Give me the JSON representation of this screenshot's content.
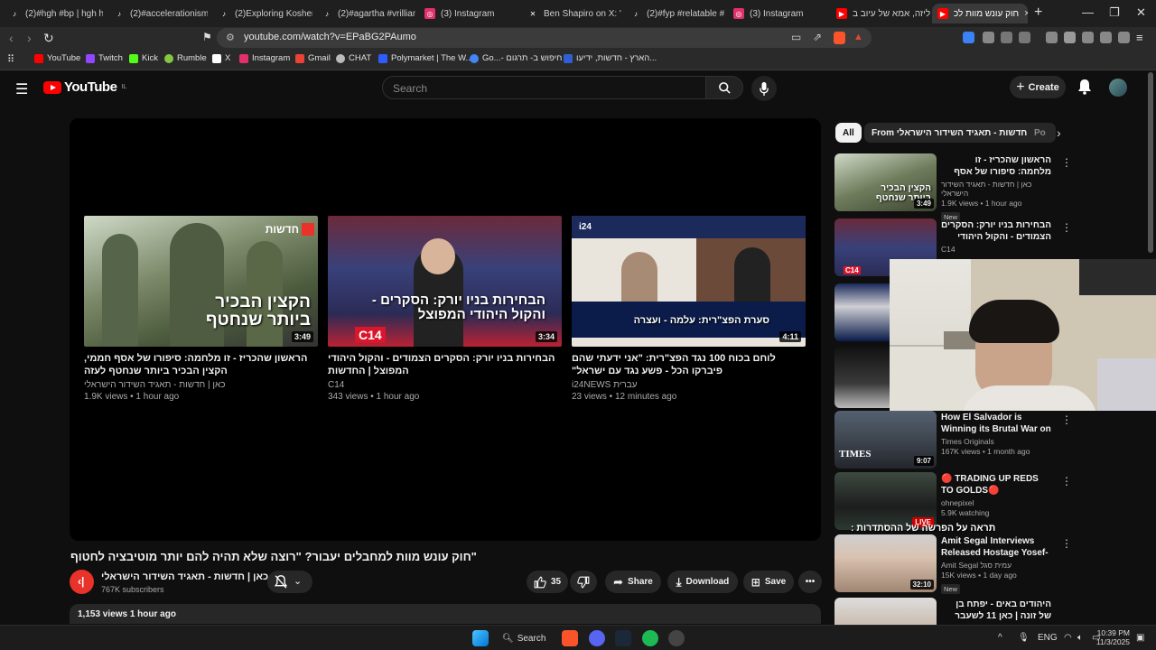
{
  "browser": {
    "tabs": [
      {
        "label": "(2)#hgh #bp | hgh hor",
        "icon": "tiktok-icon"
      },
      {
        "label": "(2)#accelerationism #",
        "icon": "tiktok-icon"
      },
      {
        "label": "(2)Exploring Kosher Cu",
        "icon": "tiktok-icon"
      },
      {
        "label": "(2)#agartha #vrilliant |",
        "icon": "tiktok-icon"
      },
      {
        "label": "(3) Instagram",
        "icon": "instagram-icon"
      },
      {
        "label": "Ben Shapiro on X: \"No",
        "icon": "x-icon"
      },
      {
        "label": "(2)#fyp #relatable #isr",
        "icon": "tiktok-icon"
      },
      {
        "label": "(3) Instagram",
        "icon": "instagram-icon"
      },
      {
        "label": "עליזה, אמא של עיוב ב",
        "icon": "youtube-icon"
      },
      {
        "label": "חוק עונש מוות לכ",
        "icon": "youtube-icon"
      }
    ],
    "new_tab": "+",
    "url": "youtube.com/watch?v=EPaBG2PAumo",
    "bookmarks": [
      {
        "label": "YouTube",
        "color": "#ff0000"
      },
      {
        "label": "Twitch",
        "color": "#9146ff"
      },
      {
        "label": "Kick",
        "color": "#53fc18"
      },
      {
        "label": "Rumble",
        "color": "#85c742"
      },
      {
        "label": "X",
        "color": "#ffffff"
      },
      {
        "label": "Instagram",
        "color": "#e1306c"
      },
      {
        "label": "Gmail",
        "color": "#ea4335"
      },
      {
        "label": "CHAT",
        "color": "#bbbbbb"
      },
      {
        "label": "Polymarket | The W...",
        "color": "#2e5cff"
      },
      {
        "label": "Go...- חיפוש ב- תרגום",
        "color": "#4285f4"
      },
      {
        "label": "הארץ - חדשות, ידיעו...",
        "color": "#2f5fd0"
      }
    ]
  },
  "youtube": {
    "logo": "YouTube",
    "region": "IL",
    "search_placeholder": "Search",
    "create_label": "Create",
    "endscreen": [
      {
        "title": "הראשון שהכריז - זו מלחמה: סיפורו של אסף חממי, הקצין הבכיר ביותר שנחטף לעזה",
        "channel": "כאן | חדשות - תאגיד השידור הישראלי",
        "meta": "1.9K views • 1 hour ago",
        "duration": "3:49",
        "overlay": "הקצין הבכיר ביותר שנחטף",
        "badge": "חדשות"
      },
      {
        "title": "הבחירות בניו יורק: הסקרים הצמודים - והקול היהודי המפוצל | החדשות",
        "channel": "C14",
        "meta": "343 views • 1 hour ago",
        "duration": "3:34",
        "overlay": "הבחירות בניו יורק: הסקרים - והקול היהודי המפוצל",
        "badge": "C14"
      },
      {
        "title": "לוחם בכוח 100 נגד הפצ\"רית: \"אני ידעתי שהם פיברקו הכל - פשע נגד עם ישראל\"",
        "channel": "i24NEWS עברית",
        "meta": "23 views • 12 minutes ago",
        "duration": "4:11",
        "overlay": "סערת הפצ\"רית: עלמה - ועצרה",
        "badge": "i24"
      }
    ],
    "video": {
      "title": "\"חוק עונש מוות למחבלים יעבור? \"רוצה שלא תהיה להם יותר מוטיבציה לחטוף",
      "channel": "כאן | חדשות - תאגיד השידור הישראלי",
      "subscribers": "767K subscribers",
      "likes": "35",
      "share": "Share",
      "download": "Download",
      "save": "Save",
      "views_time": "1,153 views  1 hour ago"
    },
    "chips": [
      "All",
      "From כאן | חדשות - תאגיד השידור הישראלי",
      "Po"
    ],
    "sidebar": [
      {
        "title": "הראשון שהכריז - זו מלחמה: סיפורו של אסף חממי, הקצין הבכיר ביותר",
        "channel": "כאן | חדשות - תאגיד השידור הישראלי",
        "meta": "1.9K views • 1 hour ago",
        "badge": "New",
        "duration": "3:49"
      },
      {
        "title": "הבחירות בניו יורק: הסקרים הצמודים - והקול היהודי המפוצל | החדשות",
        "channel": "C14",
        "meta": "",
        "badge": "",
        "duration": ""
      },
      {
        "title": "How El Salvador is Winning its Brutal War on Gangs",
        "channel": "Times Originals",
        "meta": "167K views • 1 month ago",
        "badge": "",
        "duration": "9:07"
      },
      {
        "title": "🔴 TRADING UP REDS TO GOLDS🔴",
        "channel": "ohnepixel",
        "meta": "5.9K watching",
        "badge": "",
        "duration": "LIVE"
      },
      {
        "title": "Amit Segal Interviews Released Hostage Yosef-Haim Ohana",
        "channel": "Amit Segal עמית סגל",
        "meta": "15K views • 1 day ago",
        "badge": "New",
        "duration": "32:10"
      },
      {
        "title": "היהודים באים - יפתח בן של זונה | כאן 11 לשעבר רשות השידור",
        "channel": "",
        "meta": "",
        "badge": "",
        "duration": ""
      }
    ],
    "overlay_caption": "תראה על הפרשה של ההסתדרות :"
  },
  "taskbar": {
    "search": "Search",
    "lang": "ENG",
    "time": "10:39 PM",
    "date": "11/3/2025"
  }
}
